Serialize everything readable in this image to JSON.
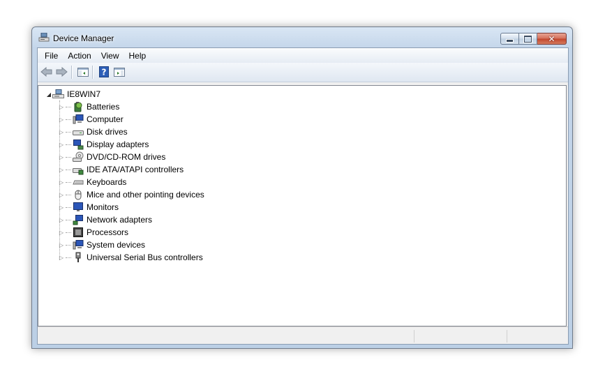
{
  "window": {
    "title": "Device Manager"
  },
  "menu": {
    "items": [
      "File",
      "Action",
      "View",
      "Help"
    ]
  },
  "toolbar": {
    "buttons": [
      "back-icon",
      "forward-icon",
      "show-hide-console-tree-icon",
      "help-icon",
      "properties-pane-icon"
    ]
  },
  "tree": {
    "root": {
      "label": "IE8WIN7",
      "icon": "computer-root-icon",
      "expanded": true
    },
    "children": [
      {
        "label": "Batteries",
        "icon": "battery-icon"
      },
      {
        "label": "Computer",
        "icon": "computer-icon"
      },
      {
        "label": "Disk drives",
        "icon": "disk-drive-icon"
      },
      {
        "label": "Display adapters",
        "icon": "display-adapter-icon"
      },
      {
        "label": "DVD/CD-ROM drives",
        "icon": "dvd-drive-icon"
      },
      {
        "label": "IDE ATA/ATAPI controllers",
        "icon": "ide-controller-icon"
      },
      {
        "label": "Keyboards",
        "icon": "keyboard-icon"
      },
      {
        "label": "Mice and other pointing devices",
        "icon": "mouse-icon"
      },
      {
        "label": "Monitors",
        "icon": "monitor-icon"
      },
      {
        "label": "Network adapters",
        "icon": "network-adapter-icon"
      },
      {
        "label": "Processors",
        "icon": "processor-icon"
      },
      {
        "label": "System devices",
        "icon": "system-devices-icon"
      },
      {
        "label": "Universal Serial Bus controllers",
        "icon": "usb-icon"
      }
    ]
  },
  "colors": {
    "title_bar": "#c4d6ea",
    "close_button": "#c1442c",
    "tree_background": "#ffffff"
  }
}
